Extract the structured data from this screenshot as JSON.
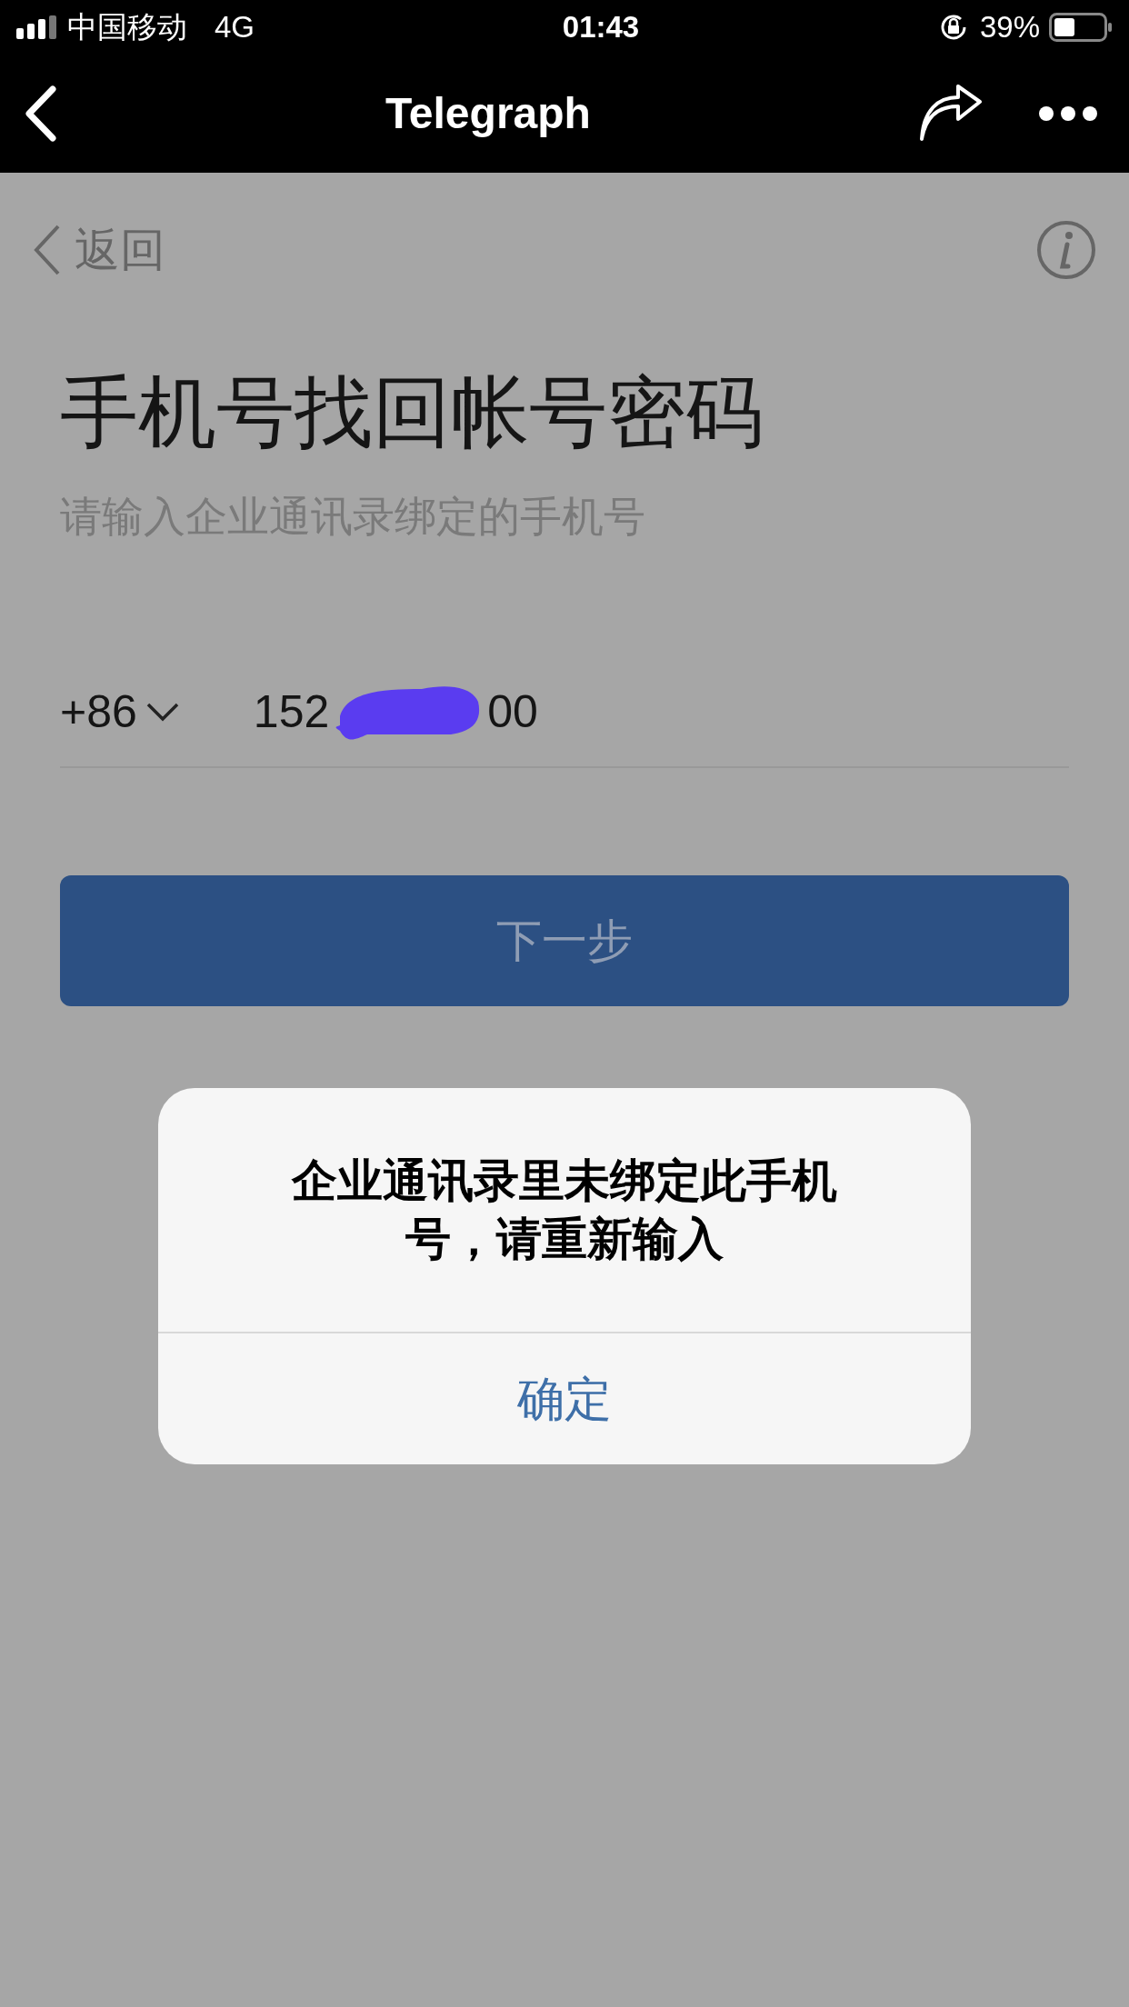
{
  "status_bar": {
    "carrier": "中国移动",
    "network": "4G",
    "time": "01:43",
    "battery": "39%"
  },
  "nav_bar": {
    "title": "Telegraph"
  },
  "page": {
    "back_label": "返回",
    "title": "手机号找回帐号密码",
    "subtitle": "请输入企业通讯录绑定的手机号",
    "phone": {
      "country_code": "+86",
      "number_start": "152",
      "number_end": "00"
    },
    "next_button": "下一步"
  },
  "dialog": {
    "message": "企业通讯录里未绑定此手机号，请重新输入",
    "button": "确定"
  }
}
